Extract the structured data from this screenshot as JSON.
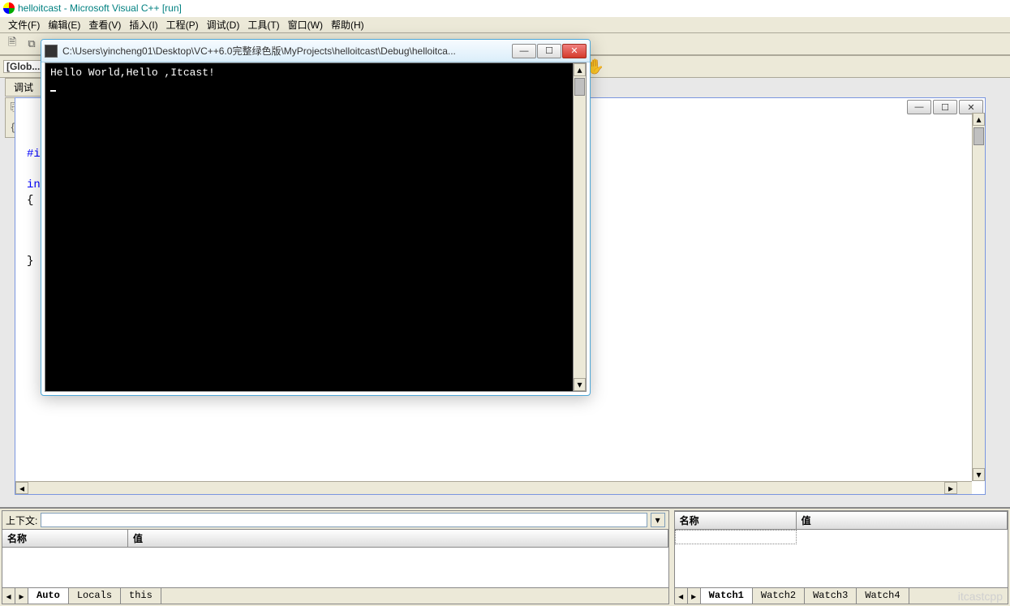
{
  "ide": {
    "title": "helloitcast - Microsoft Visual C++ [run]"
  },
  "menus": {
    "file": "文件(F)",
    "edit": "编辑(E)",
    "view": "查看(V)",
    "insert": "插入(I)",
    "project": "工程(P)",
    "debug": "调试(D)",
    "tools": "工具(T)",
    "window": "窗口(W)",
    "help": "帮助(H)"
  },
  "toolbar": {
    "globals_label": "[Glob..."
  },
  "debug_tab": "调试",
  "code": {
    "line1_a": "#i",
    "blank": "",
    "line2_a": "in",
    "line3": "{",
    "line7": "}"
  },
  "console": {
    "title": "C:\\Users\\yincheng01\\Desktop\\VC++6.0完整绿色版\\MyProjects\\helloitcast\\Debug\\helloitca...",
    "output": "Hello World,Hello ,Itcast!"
  },
  "var_panel": {
    "context_label": "上下文:",
    "context_value": "",
    "col_name": "名称",
    "col_value": "值",
    "tabs": {
      "auto": "Auto",
      "locals": "Locals",
      "this": "this"
    }
  },
  "watch_panel": {
    "col_name": "名称",
    "col_value": "值",
    "tabs": {
      "w1": "Watch1",
      "w2": "Watch2",
      "w3": "Watch3",
      "w4": "Watch4"
    },
    "watermark": "itcastcpp"
  },
  "glyphs": {
    "tri_up": "▴",
    "tri_down": "▾",
    "tri_left": "◂",
    "tri_right": "▸",
    "min": "—",
    "max": "☐",
    "close": "✕",
    "hand": "✋",
    "doc": "🗎",
    "copy": "⧉"
  }
}
